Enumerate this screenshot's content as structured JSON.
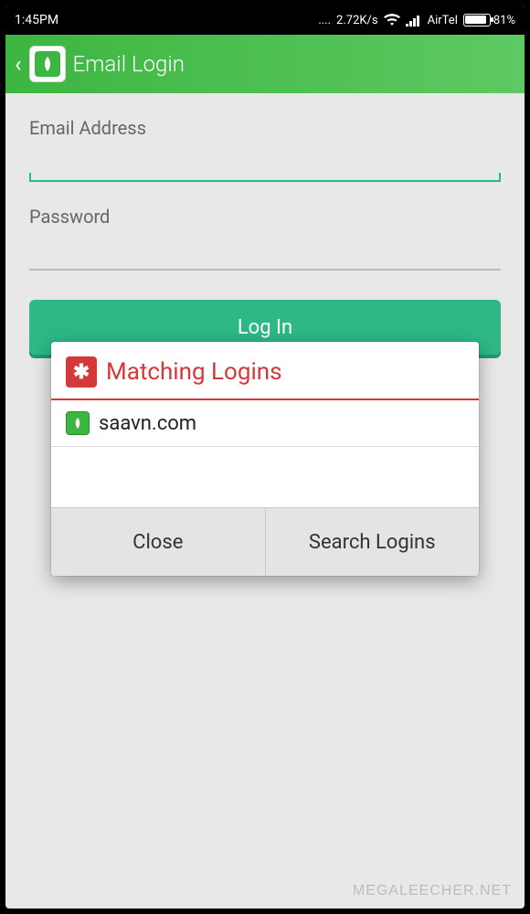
{
  "status_bar": {
    "time": "1:45PM",
    "speed": "2.72K/s",
    "carrier": "AirTel",
    "battery_percent": "81%"
  },
  "header": {
    "title": "Email Login"
  },
  "form": {
    "email_label": "Email Address",
    "email_value": "",
    "password_label": "Password",
    "password_value": "",
    "login_button": "Log In"
  },
  "dialog": {
    "title": "Matching Logins",
    "items": [
      {
        "label": "saavn.com"
      }
    ],
    "close_button": "Close",
    "search_button": "Search Logins"
  },
  "watermark": "MEGALEECHER.NET"
}
